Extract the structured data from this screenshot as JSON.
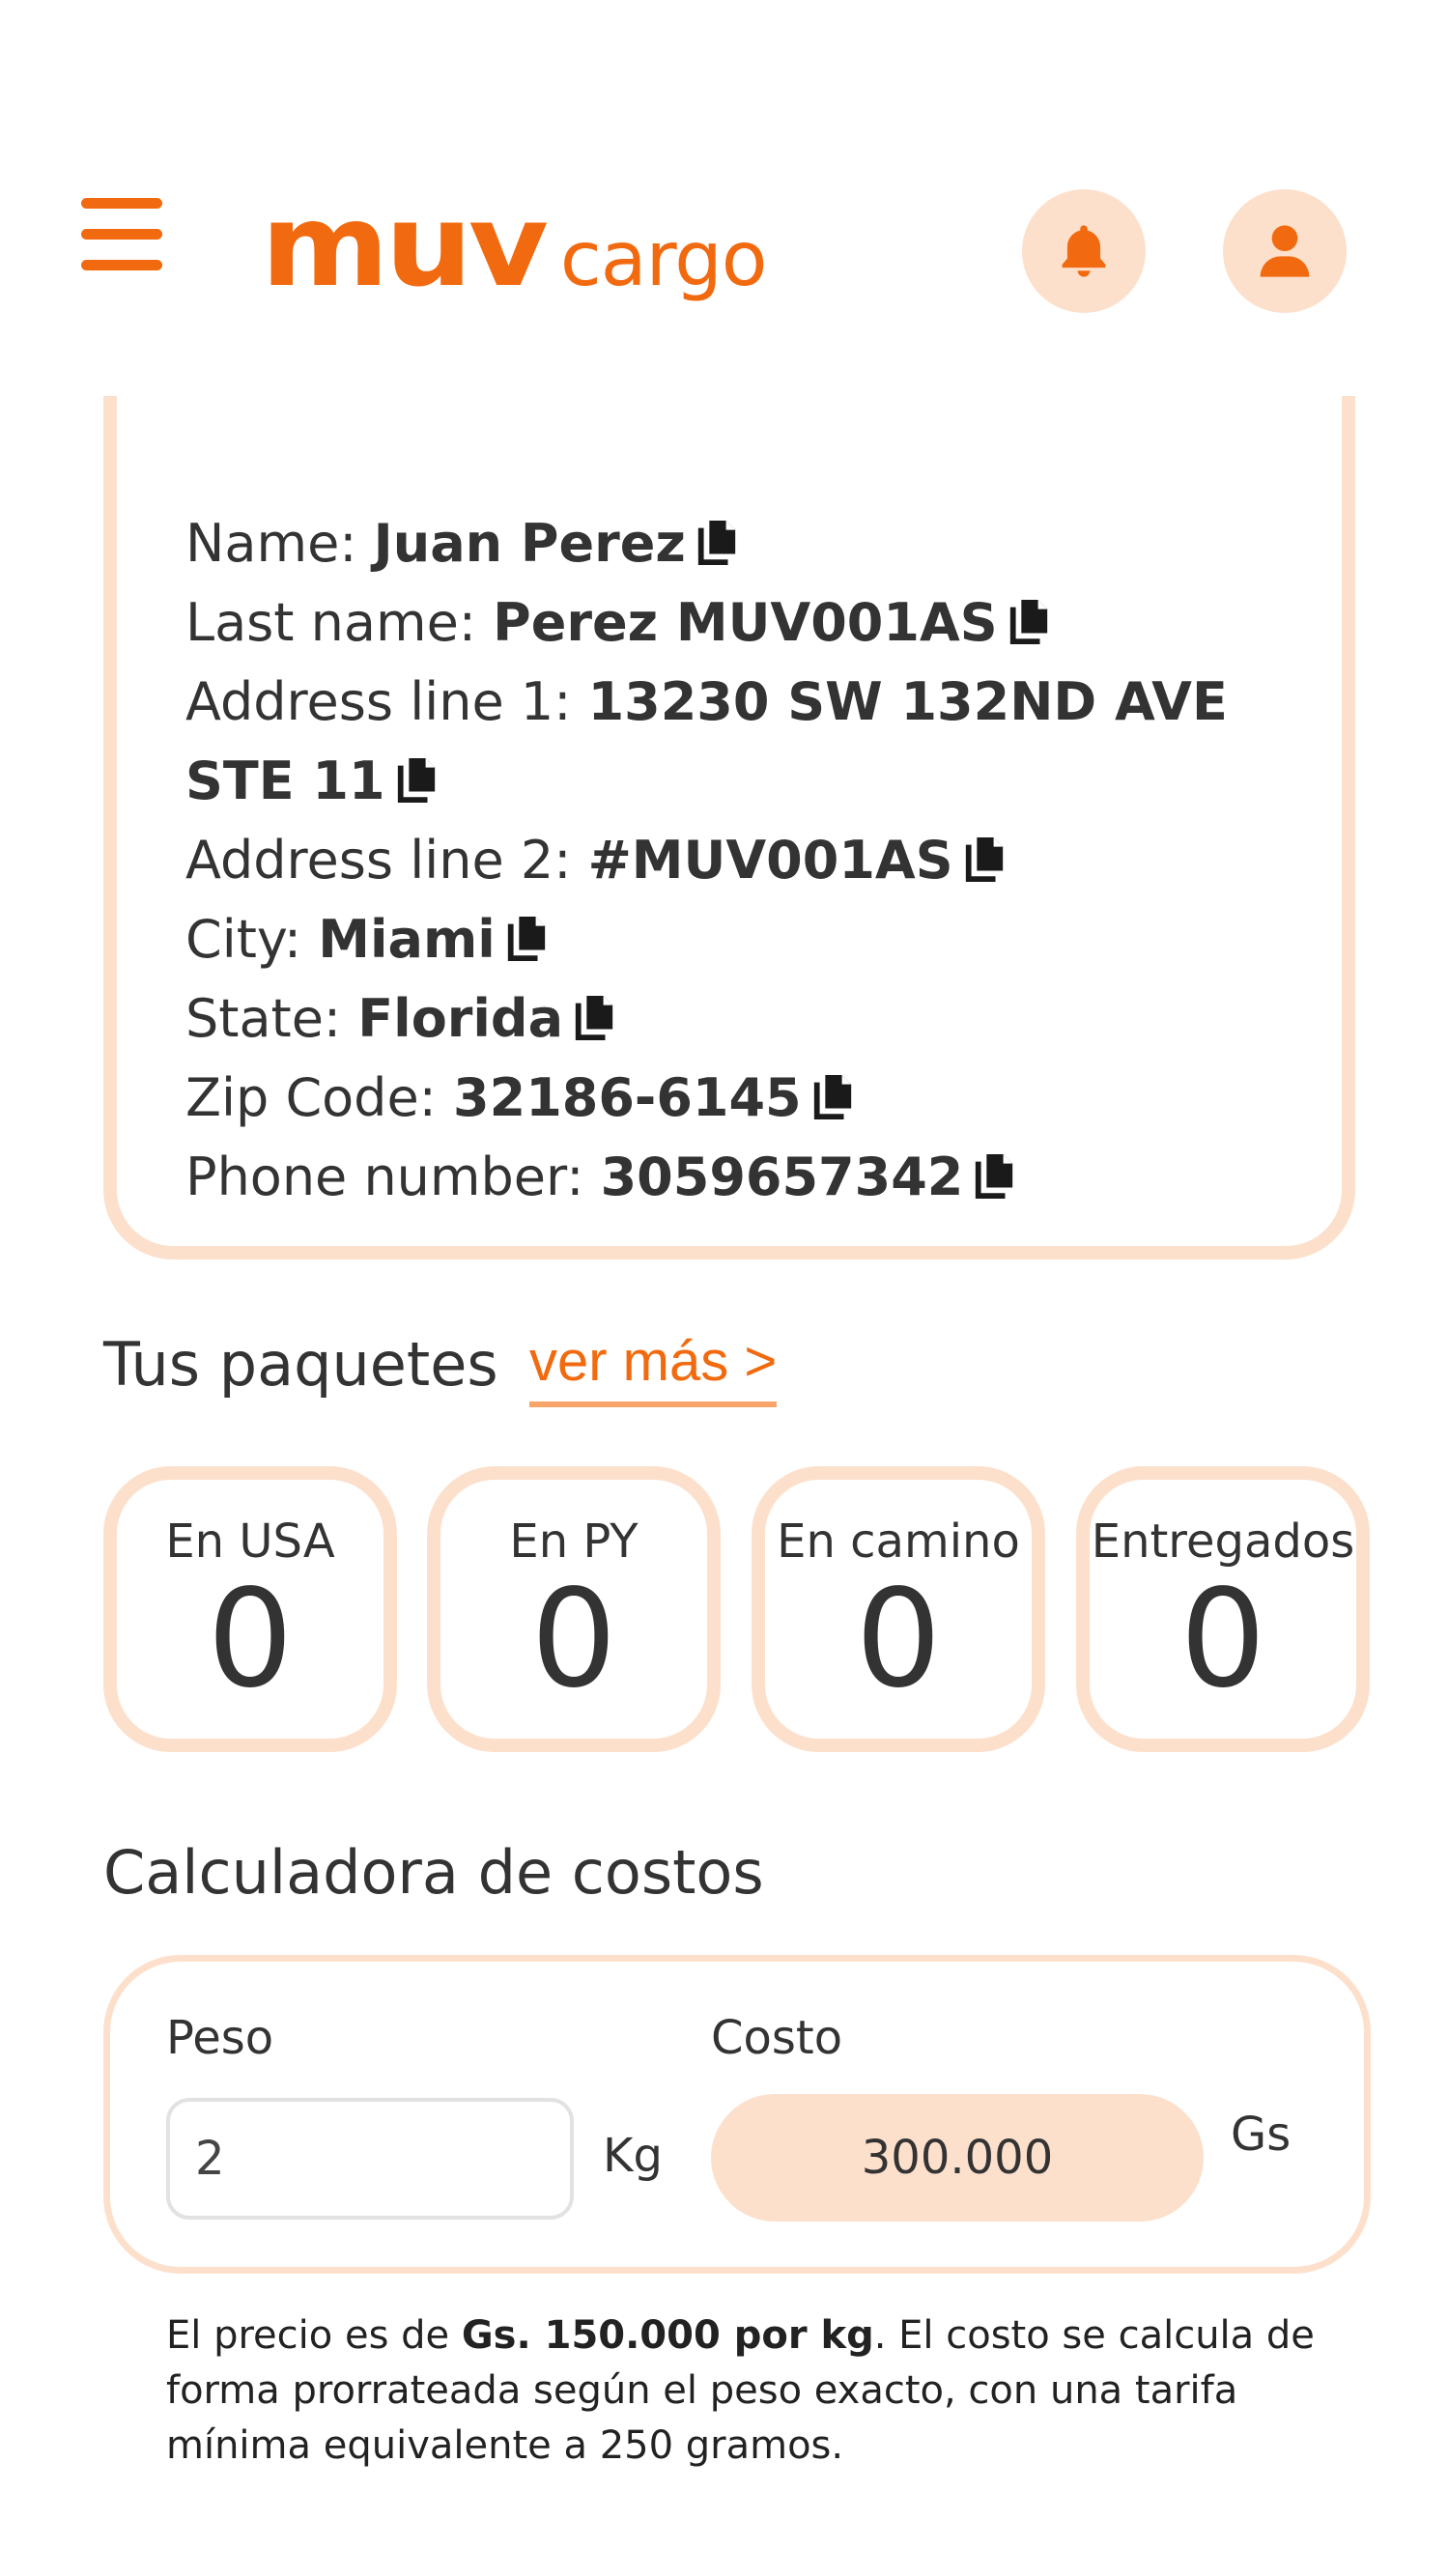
{
  "header": {
    "logo_main": "muv",
    "logo_sub": "cargo",
    "menu_icon": "hamburger-menu-icon",
    "notification_icon": "bell-icon",
    "profile_icon": "user-icon",
    "accent_color": "#f26a0f",
    "accent_light": "#fde0cc"
  },
  "address": {
    "lines": [
      {
        "label": "Name: ",
        "value": "Juan Perez"
      },
      {
        "label": "Last name: ",
        "value": "Perez MUV001AS"
      },
      {
        "label": "Address line 1: ",
        "value": "13230 SW 132ND AVE STE 11"
      },
      {
        "label": "Address line 2: ",
        "value": "#MUV001AS"
      },
      {
        "label": "City: ",
        "value": "Miami"
      },
      {
        "label": "State: ",
        "value": "Florida"
      },
      {
        "label": "Zip Code: ",
        "value": "32186-6145"
      },
      {
        "label": "Phone number: ",
        "value": "3059657342"
      }
    ],
    "copy_icon": "copy-icon"
  },
  "packages": {
    "title": "Tus paquetes",
    "more_link": "ver más >",
    "items": [
      {
        "label": "En USA",
        "count": "0"
      },
      {
        "label": "En PY",
        "count": "0"
      },
      {
        "label": "En camino",
        "count": "0"
      },
      {
        "label": "Entregados",
        "count": "0"
      }
    ]
  },
  "calculator": {
    "title": "Calculadora de costos",
    "weight_label": "Peso",
    "weight_value": "2",
    "weight_unit": "Kg",
    "cost_label": "Costo",
    "cost_value": "300.000",
    "cost_unit": "Gs",
    "note_prefix": "El precio es de ",
    "note_bold": "Gs. 150.000 por kg",
    "note_suffix": ". El costo se calcula de forma prorrateada según el peso exacto, con una tarifa mínima equivalente a 250 gramos."
  }
}
